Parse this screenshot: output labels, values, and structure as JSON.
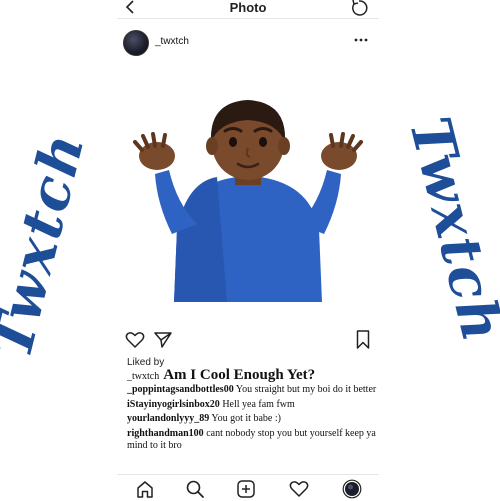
{
  "branding": {
    "text_left": "Twxtch",
    "text_right": "Twxtch",
    "color": "#1f4e99"
  },
  "topbar": {
    "title": "Photo",
    "back_icon": "chevron-left-icon",
    "refresh_icon": "refresh-icon"
  },
  "post": {
    "username": "_twxtch",
    "more_icon": "more-horizontal-icon",
    "image": "shrugging-man-emoji",
    "actions": [
      "heart-icon",
      "send-icon",
      "bookmark-icon"
    ],
    "liked_by": "Liked by",
    "caption": {
      "username": "_twxtch",
      "text": "Am I Cool Enough Yet?"
    },
    "comments": [
      {
        "username": "_poppintagsandbottles00",
        "text": "You straight but my boi do it better"
      },
      {
        "username": "iStayinyogirlsinbox20",
        "text": "Hell yea fam fwm"
      },
      {
        "username": "yourlandonlyyy_89",
        "text": "You got it babe :)"
      },
      {
        "username": "righthandman100",
        "text": "cant nobody stop you but yourself keep ya mind to it bro"
      }
    ]
  },
  "bottom_nav": [
    "home-icon",
    "search-icon",
    "add-post-icon",
    "activity-heart-icon",
    "profile-avatar-icon"
  ]
}
